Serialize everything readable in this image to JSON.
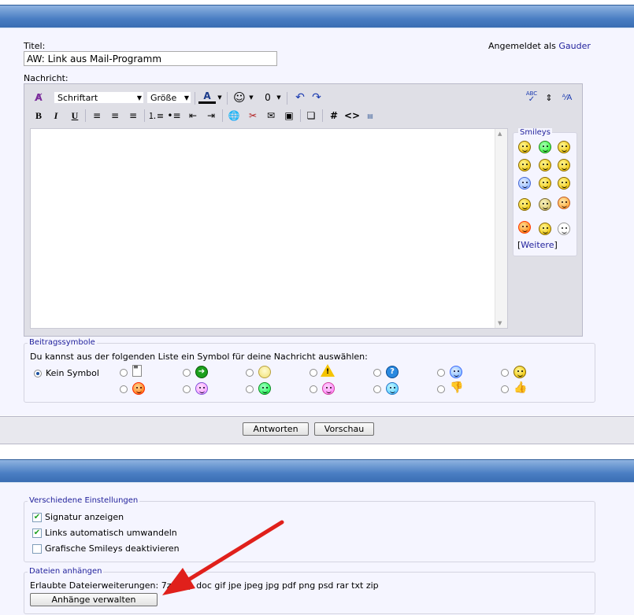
{
  "top": {
    "titel_label": "Titel:",
    "titel_value": "AW: Link aus Mail-Programm",
    "nachricht_label": "Nachricht:",
    "logged_in_prefix": "Angemeldet als",
    "logged_in_user": "Gauder"
  },
  "toolbar": {
    "font_select": "Schriftart",
    "size_select": "Größe",
    "bold": "B",
    "italic": "I",
    "underline": "U",
    "hash": "#",
    "code": "<>",
    "abc": "ABC"
  },
  "smileys": {
    "legend": "Smileys",
    "more_open": "[",
    "more_link": "Weitere",
    "more_close": "]"
  },
  "post_icons": {
    "legend": "Beitragssymbole",
    "instruction": "Du kannst aus der folgenden Liste ein Symbol für deine Nachricht auswählen:",
    "no_symbol": "Kein Symbol"
  },
  "buttons": {
    "reply": "Antworten",
    "preview": "Vorschau",
    "manage_attachments": "Anhänge verwalten"
  },
  "settings": {
    "legend": "Verschiedene Einstellungen",
    "signature": "Signatur anzeigen",
    "signature_checked": true,
    "auto_links": "Links automatisch umwandeln",
    "auto_links_checked": true,
    "disable_smileys": "Grafische Smileys deaktivieren",
    "disable_smileys_checked": false
  },
  "attachments": {
    "legend": "Dateien anhängen",
    "allowed_text": "Erlaubte Dateierweiterungen: 7z bmp doc gif jpe jpeg jpg pdf png psd rar txt zip"
  },
  "colors": {
    "bar": "#4a7ec3",
    "panel": "#f5f5ff",
    "link": "#22229c",
    "arrow": "#e0201b"
  }
}
